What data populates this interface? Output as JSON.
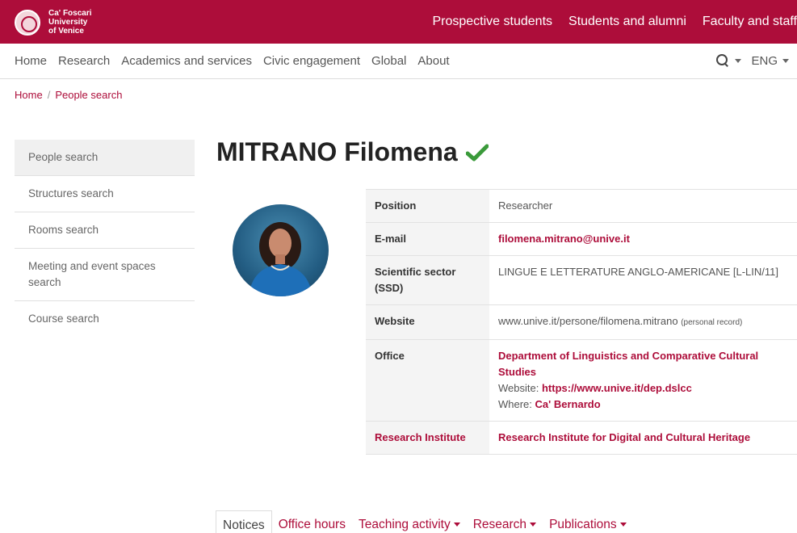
{
  "brand": {
    "line1": "Ca' Foscari",
    "line2": "University",
    "line3": "of Venice",
    "accent_color": "#ad0d3a"
  },
  "top_links": [
    "Prospective students",
    "Students and alumni",
    "Faculty and staff"
  ],
  "main_nav": [
    "Home",
    "Research",
    "Academics and services",
    "Civic engagement",
    "Global",
    "About"
  ],
  "lang": "ENG",
  "breadcrumb": {
    "home": "Home",
    "sep": "/",
    "current": "People search"
  },
  "sidebar": [
    "People search",
    "Structures search",
    "Rooms search",
    "Meeting and event spaces search",
    "Course search"
  ],
  "person": {
    "name": "MITRANO Filomena",
    "verified_icon": "check-icon",
    "position_label": "Position",
    "position": "Researcher",
    "email_label": "E-mail",
    "email": "filomena.mitrano@unive.it",
    "ssd_label": "Scientific sector (SSD)",
    "ssd": "LINGUE E LETTERATURE ANGLO-AMERICANE [L-LIN/11]",
    "website_label": "Website",
    "website": "www.unive.it/persone/filomena.mitrano",
    "website_note": "(personal record)",
    "office_label": "Office",
    "office_dept": "Department of Linguistics and Comparative Cultural Studies",
    "office_website_label": "Website:",
    "office_website": "https://www.unive.it/dep.dslcc",
    "office_where_label": "Where:",
    "office_where": "Ca' Bernardo",
    "institute_label": "Research Institute",
    "institute": "Research Institute for Digital and Cultural Heritage"
  },
  "tabs": [
    "Notices",
    "Office hours",
    "Teaching activity",
    "Research",
    "Publications"
  ]
}
